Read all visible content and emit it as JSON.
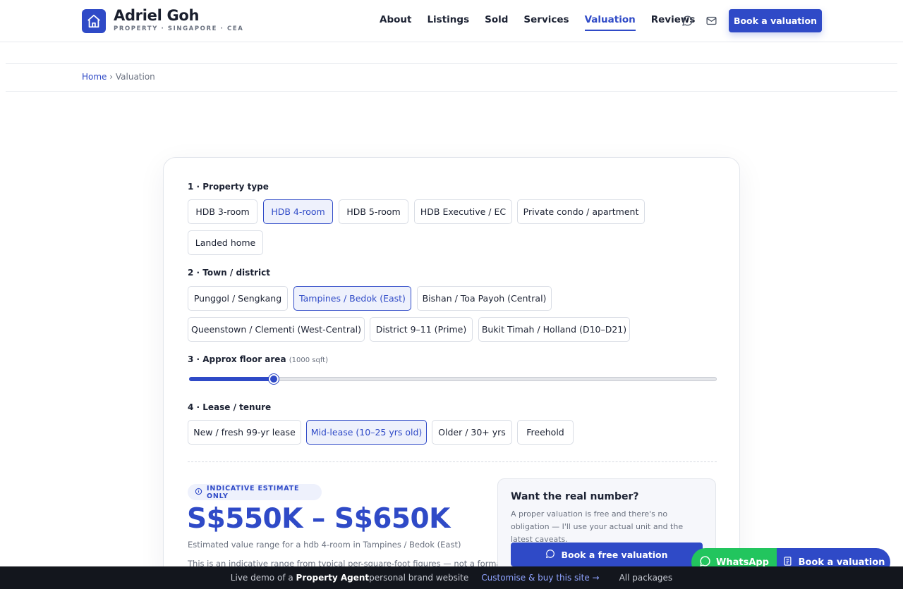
{
  "header": {
    "brand_name": "Adriel Goh",
    "brand_sub": "PROPERTY · SINGAPORE · CEA",
    "nav": [
      "About",
      "Listings",
      "Sold",
      "Services",
      "Valuation",
      "Reviews"
    ],
    "active_nav": "Valuation",
    "cta": "Book a valuation"
  },
  "breadcrumb": {
    "home": "Home",
    "sep": " › ",
    "current": "Valuation"
  },
  "form": {
    "q1": {
      "label": "1 · Property type",
      "options": [
        "HDB 3-room",
        "HDB 4-room",
        "HDB 5-room",
        "HDB Executive / EC",
        "Private condo / apartment",
        "Landed home"
      ],
      "selected": "HDB 4-room"
    },
    "q2": {
      "label": "2 · Town / district",
      "options": [
        "Punggol / Sengkang",
        "Tampines / Bedok (East)",
        "Bishan / Toa Payoh (Central)",
        "Queenstown / Clementi (West-Central)",
        "District 9–11 (Prime)",
        "Bukit Timah / Holland (D10–D21)"
      ],
      "selected": "Tampines / Bedok (East)"
    },
    "q3": {
      "label": "3 · Approx floor area",
      "hint": "(1000 sqft)",
      "value_fraction": 0.16
    },
    "q4": {
      "label": "4 · Lease / tenure",
      "options": [
        "New / fresh 99-yr lease",
        "Mid-lease (10–25 yrs old)",
        "Older / 30+ yrs",
        "Freehold"
      ],
      "selected": "Mid-lease (10–25 yrs old)"
    }
  },
  "result": {
    "badge": "INDICATIVE ESTIMATE ONLY",
    "estimate": "S$550K – S$650K",
    "subtitle": "Estimated value range for a hdb 4-room in Tampines / Bedok (East)",
    "note": "This is an indicative range from typical per-square-foot figures — not a formal"
  },
  "side": {
    "title": "Want the real number?",
    "body": "A proper valuation is free and there's no obligation — I'll use your actual unit and the latest caveats.",
    "button": "Book a free valuation"
  },
  "floating": {
    "whatsapp": "WhatsApp",
    "book": "Book a valuation"
  },
  "demo_bar": {
    "prefix": "Live demo of a ",
    "strong": "Property Agent",
    "suffix": " personal brand website",
    "link": "Customise & buy this site →",
    "packages": "All packages"
  },
  "colors": {
    "accent": "#2f4ac7",
    "whatsapp": "#22c55e",
    "bar": "#13161d"
  }
}
